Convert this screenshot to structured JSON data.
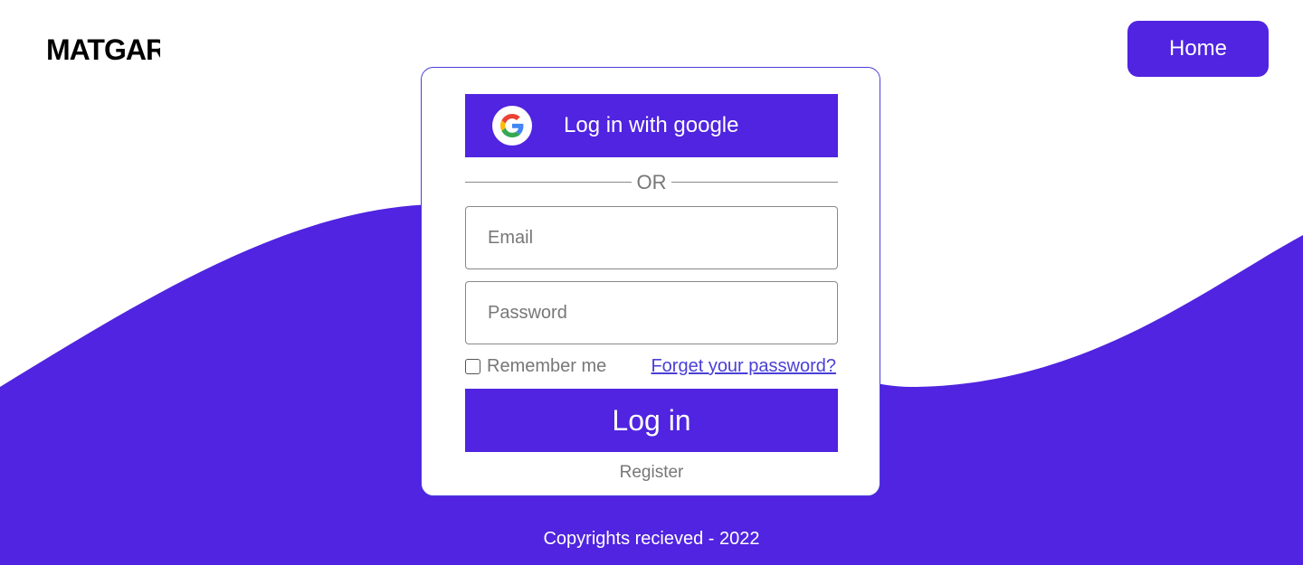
{
  "brand": {
    "logo_text": "MATGAR",
    "accent_color": "#5024E0"
  },
  "nav": {
    "home_label": "Home"
  },
  "login": {
    "google_label": "Log in with google",
    "google_icon": "google-g-icon",
    "divider_text": "OR",
    "email_placeholder": "Email",
    "password_placeholder": "Password",
    "remember_label": "Remember me",
    "forgot_label": "Forget your password?",
    "submit_label": "Log in",
    "register_label": "Register"
  },
  "footer": {
    "copyright": "Copyrights recieved - 2022"
  }
}
